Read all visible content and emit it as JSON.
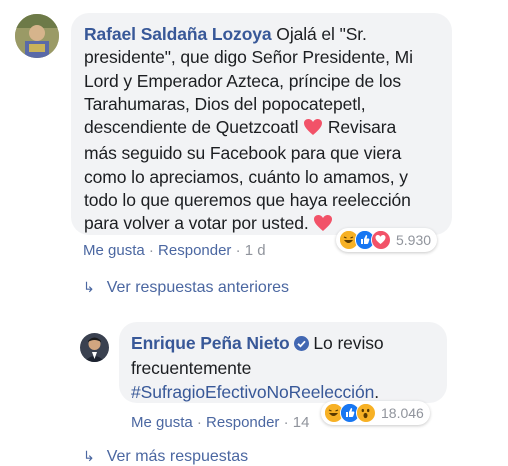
{
  "comment1": {
    "author": "Rafael Saldaña Lozoya",
    "lines": [
      " Ojalá el \"Sr.",
      "presidente\", que digo Señor Presidente, Mi",
      "Lord y Emperador Azteca, príncipe de los",
      "Tarahumaras, Dios del popocatepetl,",
      "descendiente de Quetzcoatl ",
      " Revisara",
      "más seguido su Facebook para que viera",
      "como lo apreciamos, cuánto lo amamos, y",
      "todo lo que queremos que haya reelección",
      "para volver a votar por usted. "
    ],
    "like_label": "Me gusta",
    "reply_label": "Responder",
    "time": "1 d",
    "reaction_count": "5.930",
    "reaction_icons": [
      "haha-icon",
      "like-icon",
      "love-icon"
    ]
  },
  "view_previous_replies": "Ver respuestas anteriores",
  "comment2": {
    "author": "Enrique Peña Nieto",
    "text_after_author": " Lo reviso",
    "line2": "frecuentemente",
    "hashtag": "#SufragioEfectivoNoReelección",
    "end_punct": ".",
    "like_label": "Me gusta",
    "reply_label": "Responder",
    "time": "14",
    "reaction_count": "18.046",
    "reaction_icons": [
      "haha-icon",
      "like-icon",
      "wow-icon"
    ]
  },
  "view_more_replies": "Ver más respuestas",
  "colors": {
    "link": "#385898",
    "bubble": "#f2f3f5",
    "heart": "#f25268",
    "like": "#1877f2"
  }
}
